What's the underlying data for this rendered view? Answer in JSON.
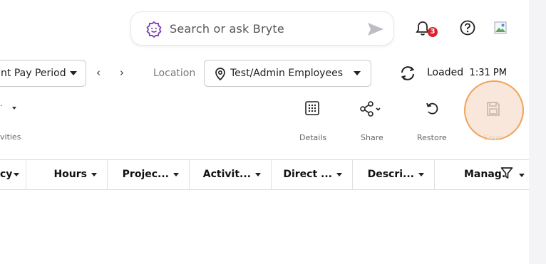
{
  "search": {
    "placeholder": "Search or ask Bryte",
    "icon": "bryte-icon",
    "send_icon": "send-icon"
  },
  "notifications": {
    "icon": "bell-icon",
    "count": "3"
  },
  "help": {
    "icon": "help-icon"
  },
  "profile": {
    "icon": "avatar-image-icon"
  },
  "toolbar": {
    "pay_period": "nt Pay Period",
    "prev": "‹",
    "next": "›",
    "location_label": "Location",
    "location_value": "Test/Admin Employees",
    "sync_icon": "sync-icon",
    "status_text": "Loaded",
    "status_time": "1:31 PM"
  },
  "actions": {
    "activities_label": "vities",
    "items": [
      {
        "name": "details",
        "label": "Details",
        "icon": "details-icon"
      },
      {
        "name": "share",
        "label": "Share",
        "icon": "share-icon"
      },
      {
        "name": "restore",
        "label": "Restore",
        "icon": "restore-icon"
      },
      {
        "name": "save",
        "label": "Save",
        "icon": "save-icon"
      }
    ]
  },
  "table": {
    "columns": [
      "cy",
      "Hours",
      "Projec...",
      "Activit...",
      "Direct ...",
      "Descri...",
      "Manag."
    ],
    "filter_icon": "filter-icon"
  },
  "colors": {
    "accent": "#7b3fb0",
    "badge": "#d9212c",
    "highlight": "#f0a35a"
  }
}
